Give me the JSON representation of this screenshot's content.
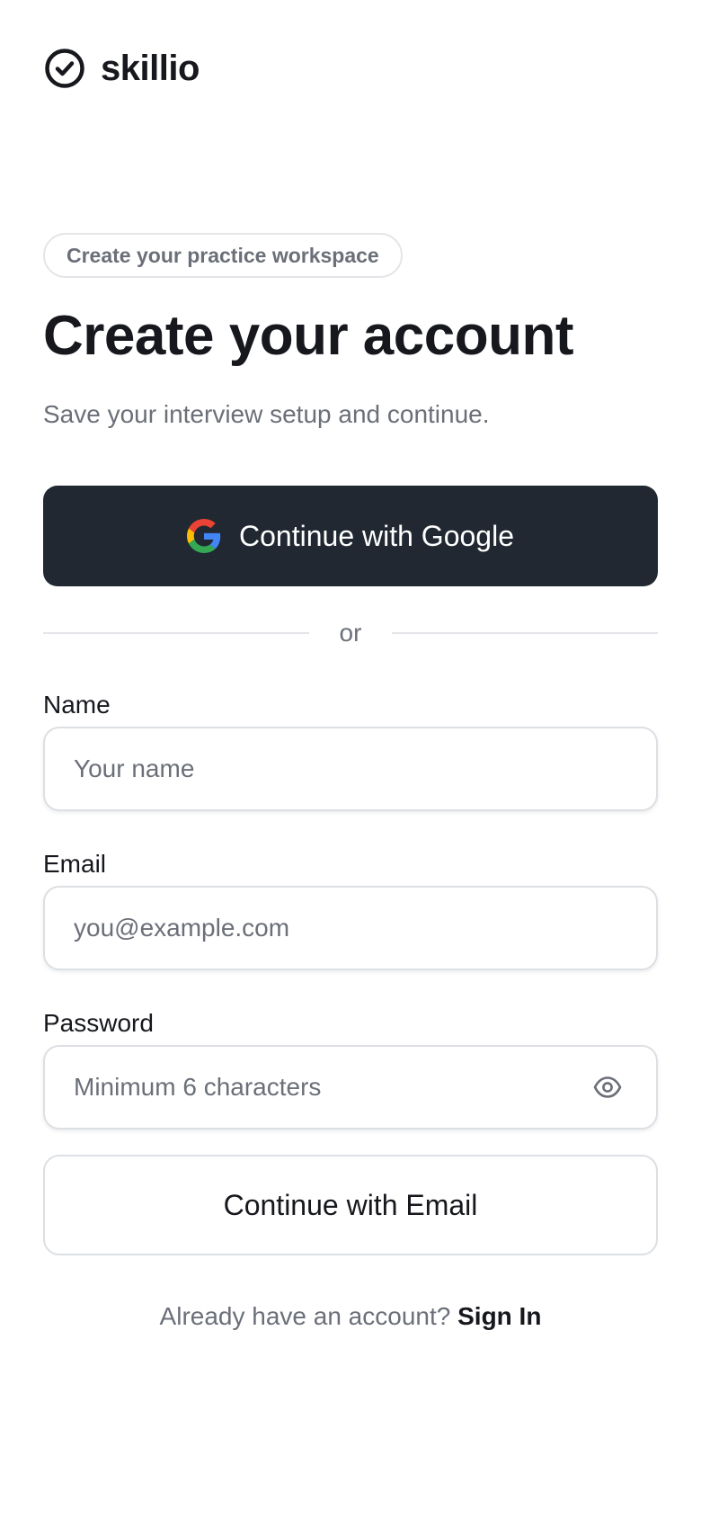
{
  "brand": {
    "name": "skillio",
    "icon": "check-circle-icon"
  },
  "header": {
    "pill": "Create your practice workspace",
    "title": "Create your account",
    "subtitle": "Save your interview setup and continue."
  },
  "auth": {
    "google_label": "Continue with Google",
    "google_icon": "google-icon",
    "divider_text": "or"
  },
  "form": {
    "name": {
      "label": "Name",
      "placeholder": "Your name",
      "value": ""
    },
    "email": {
      "label": "Email",
      "placeholder": "you@example.com",
      "value": ""
    },
    "password": {
      "label": "Password",
      "placeholder": "Minimum 6 characters",
      "value": "",
      "icon": "eye-icon"
    },
    "submit_label": "Continue with Email"
  },
  "footer": {
    "prompt": "Already have an account?",
    "signin_label": "Sign In"
  },
  "colors": {
    "primary_button": "#212832",
    "text": "#16181d",
    "muted": "#6b6f78",
    "border": "#dcdfe3"
  }
}
